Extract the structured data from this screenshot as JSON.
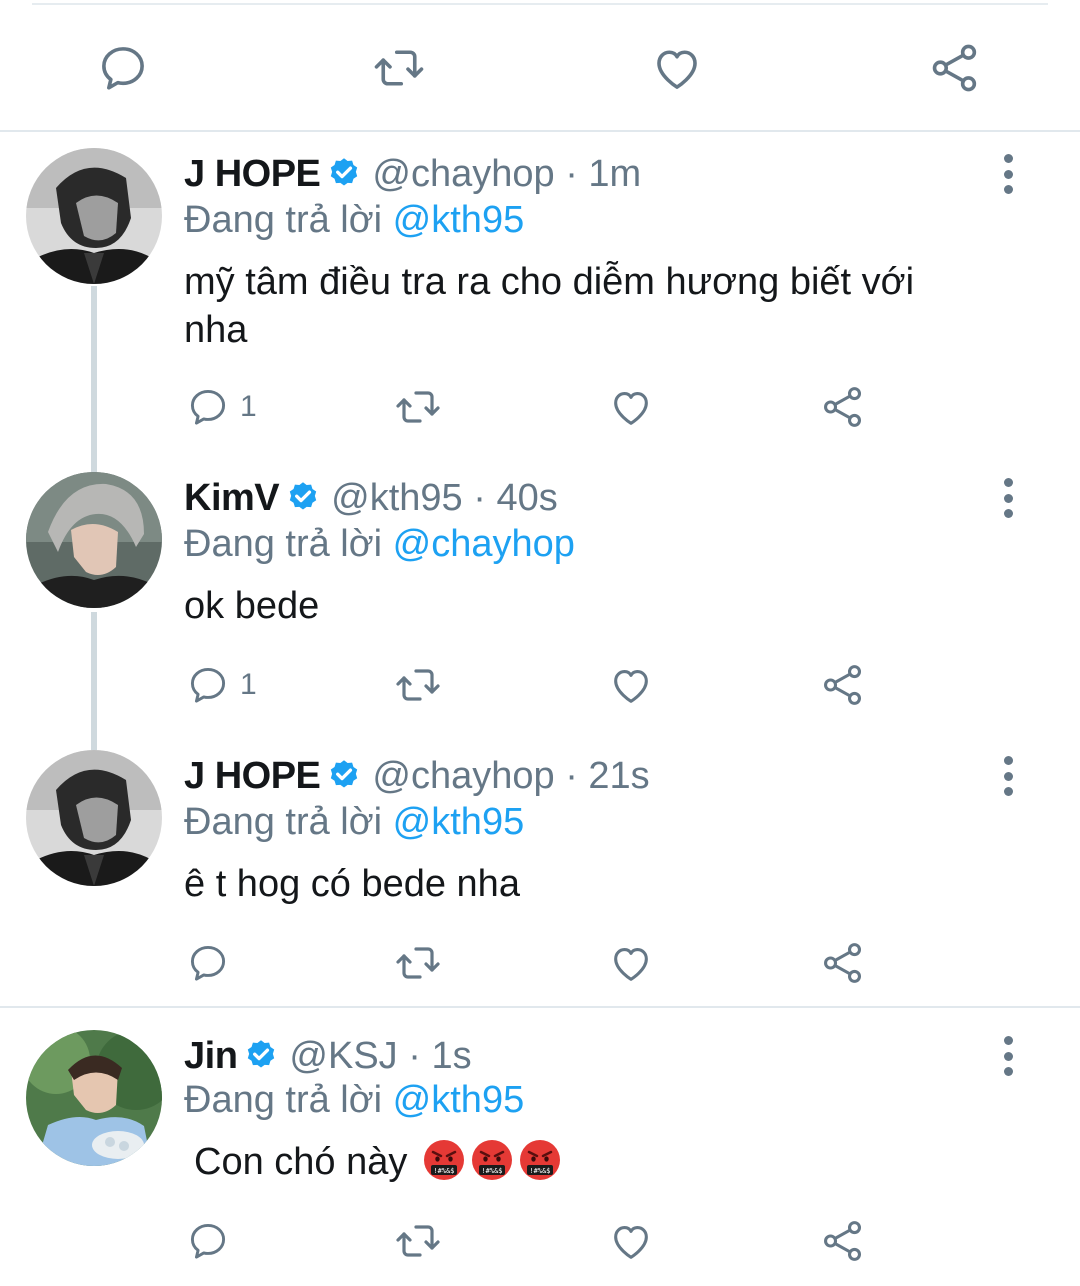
{
  "top_actions": [
    "reply-icon",
    "retweet-icon",
    "like-icon",
    "share-icon"
  ],
  "tweets": [
    {
      "name": "J HOPE",
      "handle_time": "@chayhop · 1m",
      "replying_prefix": "Đang trả lời",
      "replying_to": "@kth95",
      "text": "mỹ tâm điều tra ra cho diễm hương biết với nha",
      "reply_count": "1"
    },
    {
      "name": "KimV",
      "handle_time": "@kth95 · 40s",
      "replying_prefix": "Đang trả lời",
      "replying_to": "@chayhop",
      "text": "ok bede",
      "reply_count": "1"
    },
    {
      "name": "J HOPE",
      "handle_time": "@chayhop · 21s",
      "replying_prefix": "Đang trả lời",
      "replying_to": "@kth95",
      "text": "ê t hog có bede nha",
      "reply_count": ""
    },
    {
      "name": "Jin",
      "handle_time": "@KSJ · 1s",
      "replying_prefix": "Đang trả lời",
      "replying_to": "@kth95",
      "text": "Con chó này",
      "emojis": [
        "cursing-face-emoji",
        "cursing-face-emoji",
        "cursing-face-emoji"
      ],
      "reply_count": ""
    }
  ],
  "colors": {
    "accent": "#1da1f2",
    "icon_gray": "#657786",
    "text": "#14171a",
    "divider": "#e1e8ed"
  }
}
